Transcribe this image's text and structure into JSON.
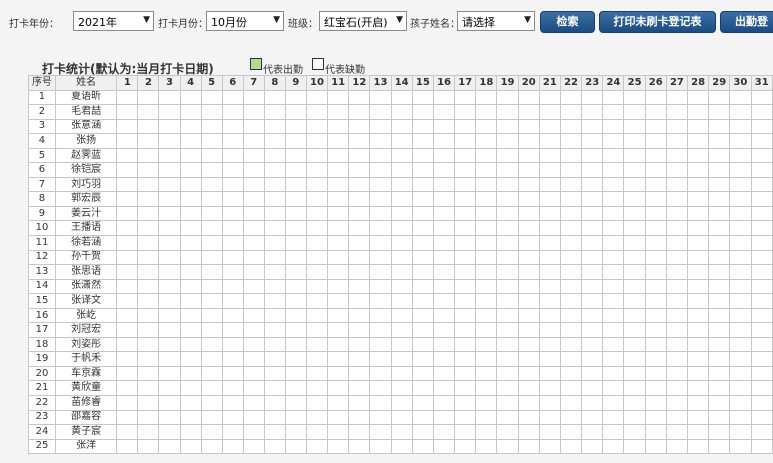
{
  "filters": {
    "year_label": "打卡年份：",
    "year_value": "2021年",
    "month_label": "打卡月份：",
    "month_value": "10月份",
    "class_label": "班级：",
    "class_value": "红宝石(开启)",
    "child_label": "孩子姓名：",
    "child_value": "请选择"
  },
  "buttons": {
    "search": "检索",
    "print": "打印未刷卡登记表",
    "attendance": "出勤登"
  },
  "stats": {
    "title": "打卡统计(默认为:当月打卡日期)",
    "legend_present": "代表出勤",
    "legend_absent": "代表缺勤",
    "present_color": "#a8e09a"
  },
  "table": {
    "col_seq": "序号",
    "col_name": "姓名",
    "days": [
      "1",
      "2",
      "3",
      "4",
      "5",
      "6",
      "7",
      "8",
      "9",
      "10",
      "11",
      "12",
      "13",
      "14",
      "15",
      "16",
      "17",
      "18",
      "19",
      "20",
      "21",
      "22",
      "23",
      "24",
      "25",
      "26",
      "27",
      "28",
      "29",
      "30",
      "31"
    ],
    "rows": [
      {
        "seq": "1",
        "name": "夏语昕"
      },
      {
        "seq": "2",
        "name": "毛君喆"
      },
      {
        "seq": "3",
        "name": "张意涵"
      },
      {
        "seq": "4",
        "name": "张扬"
      },
      {
        "seq": "5",
        "name": "赵霁蓝"
      },
      {
        "seq": "6",
        "name": "徐铠宸"
      },
      {
        "seq": "7",
        "name": "刘巧羽"
      },
      {
        "seq": "8",
        "name": "郭宏辰"
      },
      {
        "seq": "9",
        "name": "姜云汁"
      },
      {
        "seq": "10",
        "name": "王播语"
      },
      {
        "seq": "11",
        "name": "徐若涵"
      },
      {
        "seq": "12",
        "name": "孙千贺"
      },
      {
        "seq": "13",
        "name": "张思语"
      },
      {
        "seq": "14",
        "name": "张潇然"
      },
      {
        "seq": "15",
        "name": "张译文"
      },
      {
        "seq": "16",
        "name": "张屹"
      },
      {
        "seq": "17",
        "name": "刘冠宏"
      },
      {
        "seq": "18",
        "name": "刘姿彤"
      },
      {
        "seq": "19",
        "name": "于帆禾"
      },
      {
        "seq": "20",
        "name": "车京霖"
      },
      {
        "seq": "21",
        "name": "黄欣童"
      },
      {
        "seq": "22",
        "name": "苗修睿"
      },
      {
        "seq": "23",
        "name": "邵嘉容"
      },
      {
        "seq": "24",
        "name": "黄子宸"
      },
      {
        "seq": "25",
        "name": "张洋"
      }
    ]
  }
}
